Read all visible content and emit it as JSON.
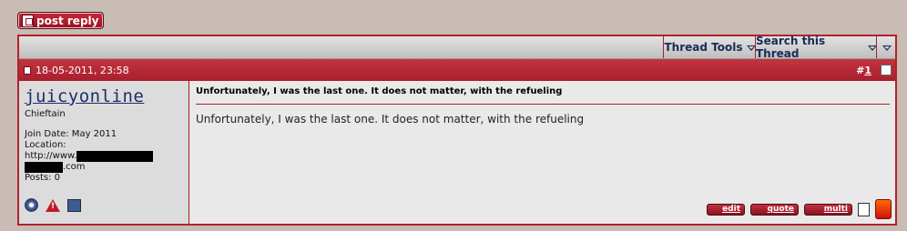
{
  "reply_button": {
    "label": "post reply"
  },
  "toolbar": {
    "thread_tools": "Thread Tools",
    "search_thread": "Search this Thread"
  },
  "post": {
    "date": "18-05-2011, 23:58",
    "number_prefix": "#",
    "number": "1",
    "title": "Unfortunately, I was the last one. It does not matter, with the refueling",
    "body": "Unfortunately, I was the last one. It does not matter, with the refueling"
  },
  "user": {
    "name": "juicyonline",
    "title": "Chieftain",
    "join_date": "Join Date: May 2011",
    "location_label": "Location:",
    "location_prefix": "http://www.",
    "location_suffix": ".com",
    "posts": "Posts: 0"
  },
  "actions": {
    "edit": "edit",
    "quote": "quote",
    "multi": "multi"
  },
  "colors": {
    "accent": "#b0222e",
    "link": "#1c2d6a"
  }
}
